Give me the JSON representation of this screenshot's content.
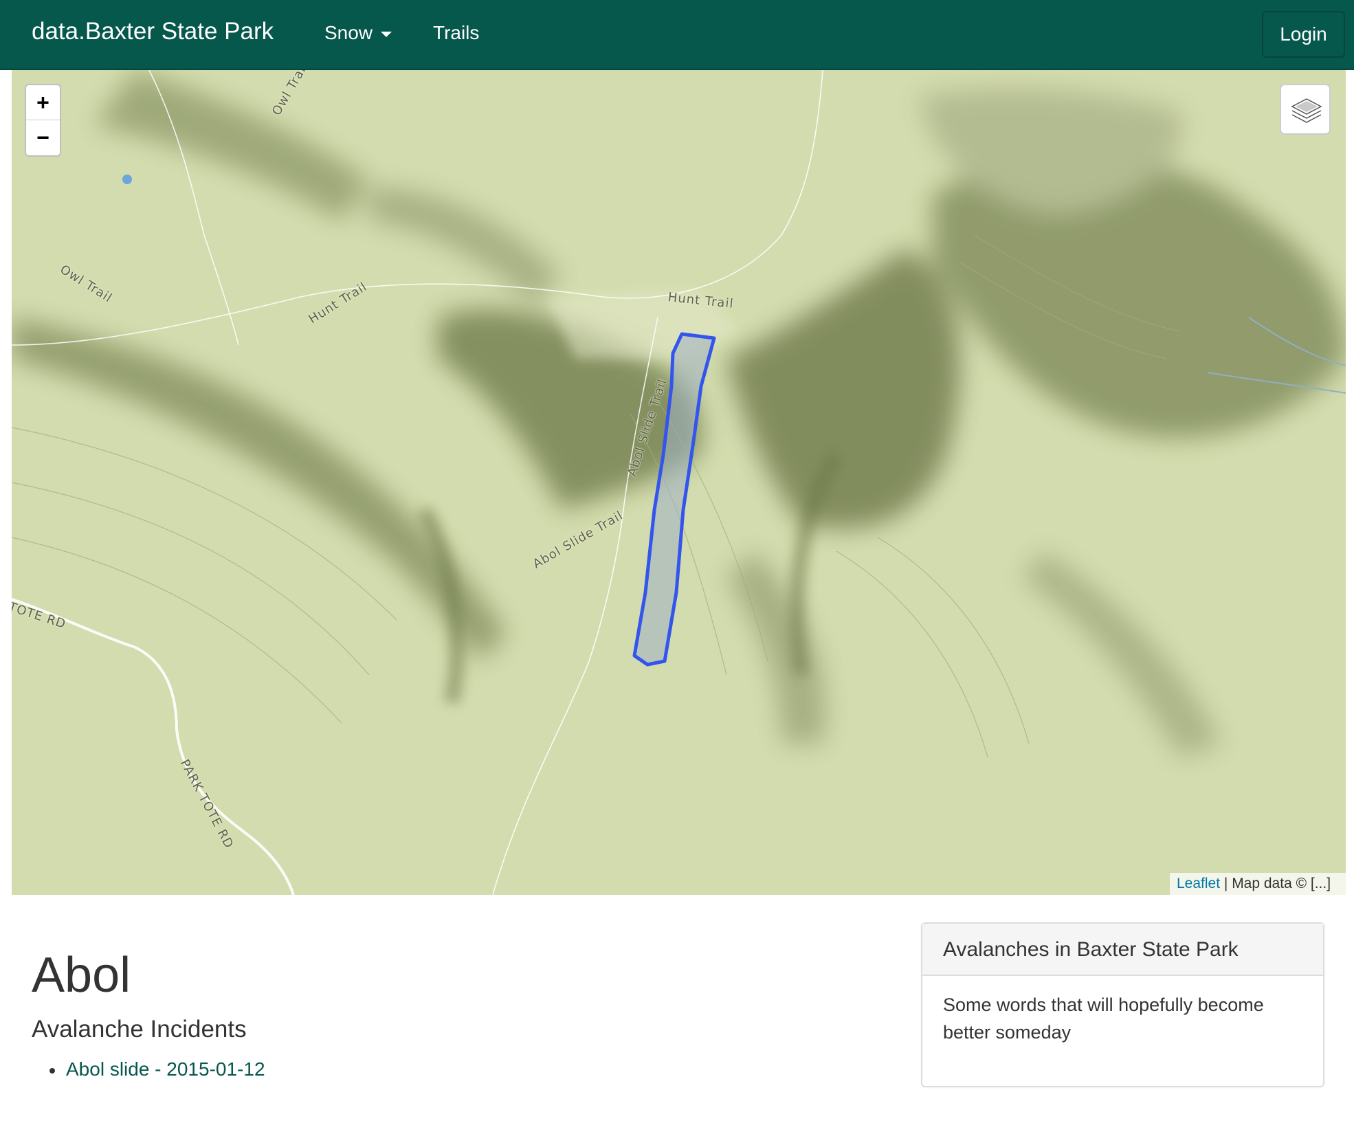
{
  "navbar": {
    "brand": "data.Baxter State Park",
    "items": [
      {
        "label": "Snow",
        "dropdown": true
      },
      {
        "label": "Trails",
        "dropdown": false
      }
    ],
    "login_label": "Login",
    "background_color": "#06574c"
  },
  "map": {
    "zoom_in_label": "+",
    "zoom_out_label": "−",
    "layers_icon": "layers-icon",
    "attribution": {
      "link_text": "Leaflet",
      "separator": " | ",
      "text": "Map data © [...]"
    },
    "trail_labels": {
      "owl_trail_1": "Owl Trail",
      "owl_trail_2": "Owl Trail",
      "hunt_trail_1": "Hunt Trail",
      "hunt_trail_2": "Hunt Trail",
      "abol_slide_trail_1": "Abol Slide Trail",
      "abol_slide_trail_2": "Abol Slide Trail",
      "tote_rd": "TOTE RD",
      "park_tote_rd": "PARK TOTE RD"
    },
    "terrain_color": "#d3dcae",
    "polygon_color": "#3355ee"
  },
  "page": {
    "title": "Abol",
    "subtitle": "Avalanche Incidents",
    "incidents": [
      {
        "label": "Abol slide - 2015-01-12"
      }
    ]
  },
  "panel": {
    "heading": "Avalanches in Baxter State Park",
    "body": "Some words that will hopefully become better someday"
  }
}
